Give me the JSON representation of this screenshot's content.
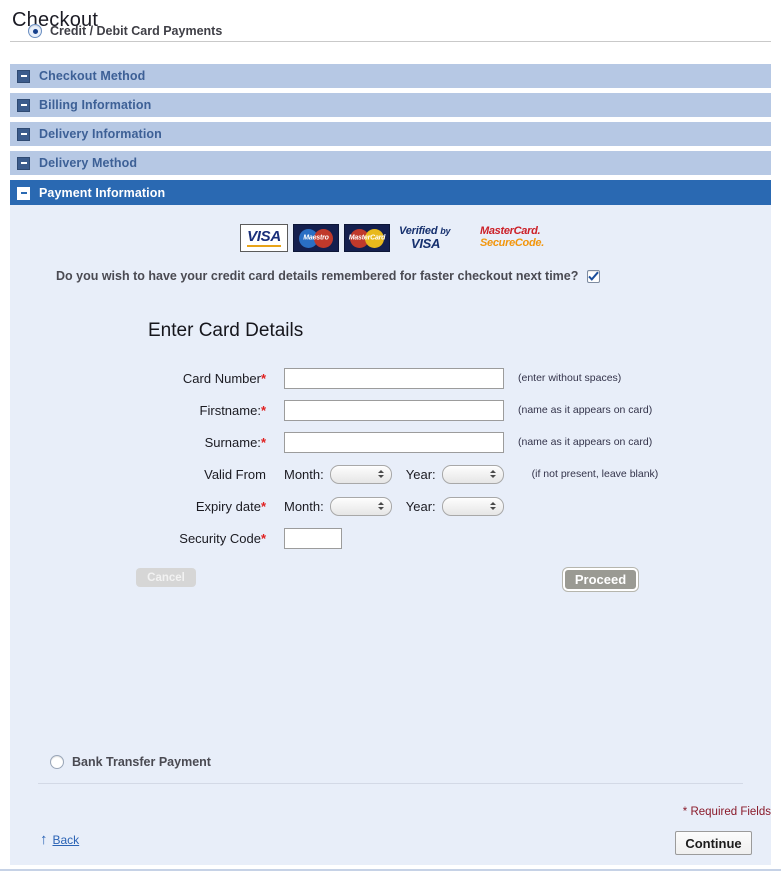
{
  "page": {
    "title": "Checkout"
  },
  "accordion": {
    "sections": [
      {
        "label": "Checkout Method",
        "active": false
      },
      {
        "label": "Billing Information",
        "active": false
      },
      {
        "label": "Delivery Information",
        "active": false
      },
      {
        "label": "Delivery Method",
        "active": false
      },
      {
        "label": "Payment Information",
        "active": true
      }
    ]
  },
  "payment": {
    "card_option_label": "Credit / Debit Card Payments",
    "card_option_selected": true,
    "logos": [
      {
        "name": "visa-logo",
        "text": "VISA"
      },
      {
        "name": "maestro-logo",
        "text": "Maestro"
      },
      {
        "name": "mastercard-logo",
        "text": "MasterCard"
      },
      {
        "name": "verified-by-visa-logo",
        "line1": "Verified",
        "line1b": "by",
        "line2": "VISA"
      },
      {
        "name": "mastercard-securecode-logo",
        "line1": "MasterCard.",
        "line2": "SecureCode."
      }
    ],
    "remember_question": "Do you wish to have your credit card details remembered for faster checkout next time?",
    "remember_checked": true,
    "bank_option_label": "Bank Transfer Payment",
    "bank_option_selected": false
  },
  "card_form": {
    "heading": "Enter Card Details",
    "rows": {
      "card_number": {
        "label": "Card Number",
        "required": true,
        "value": "",
        "hint": "(enter without spaces)"
      },
      "firstname": {
        "label": "Firstname:",
        "required": true,
        "value": "",
        "hint": "(name as it appears on card)"
      },
      "surname": {
        "label": "Surname:",
        "required": true,
        "value": "",
        "hint": "(name as it appears on card)"
      },
      "valid_from": {
        "label": "Valid From",
        "required": false,
        "month_label": "Month:",
        "month_value": "",
        "year_label": "Year:",
        "year_value": "",
        "hint": "(if not present, leave blank)"
      },
      "expiry_date": {
        "label": "Expiry date",
        "required": true,
        "month_label": "Month:",
        "month_value": "",
        "year_label": "Year:",
        "year_value": "",
        "hint": ""
      },
      "security_code": {
        "label": "Security Code",
        "required": true,
        "value": "",
        "hint": ""
      }
    },
    "cancel_label": "Cancel",
    "proceed_label": "Proceed"
  },
  "footer": {
    "required_note": "* Required Fields",
    "back_label": "Back",
    "back_arrow": "↑",
    "continue_label": "Continue"
  },
  "colors": {
    "accordion_inactive": "#b6c8e4",
    "accordion_active": "#2a69b2",
    "accordion_label_inactive": "#3d6096",
    "panel_bg": "#e8eef9",
    "link": "#2b63b5",
    "required_red": "#e02020",
    "required_note": "#8a1a2a"
  }
}
